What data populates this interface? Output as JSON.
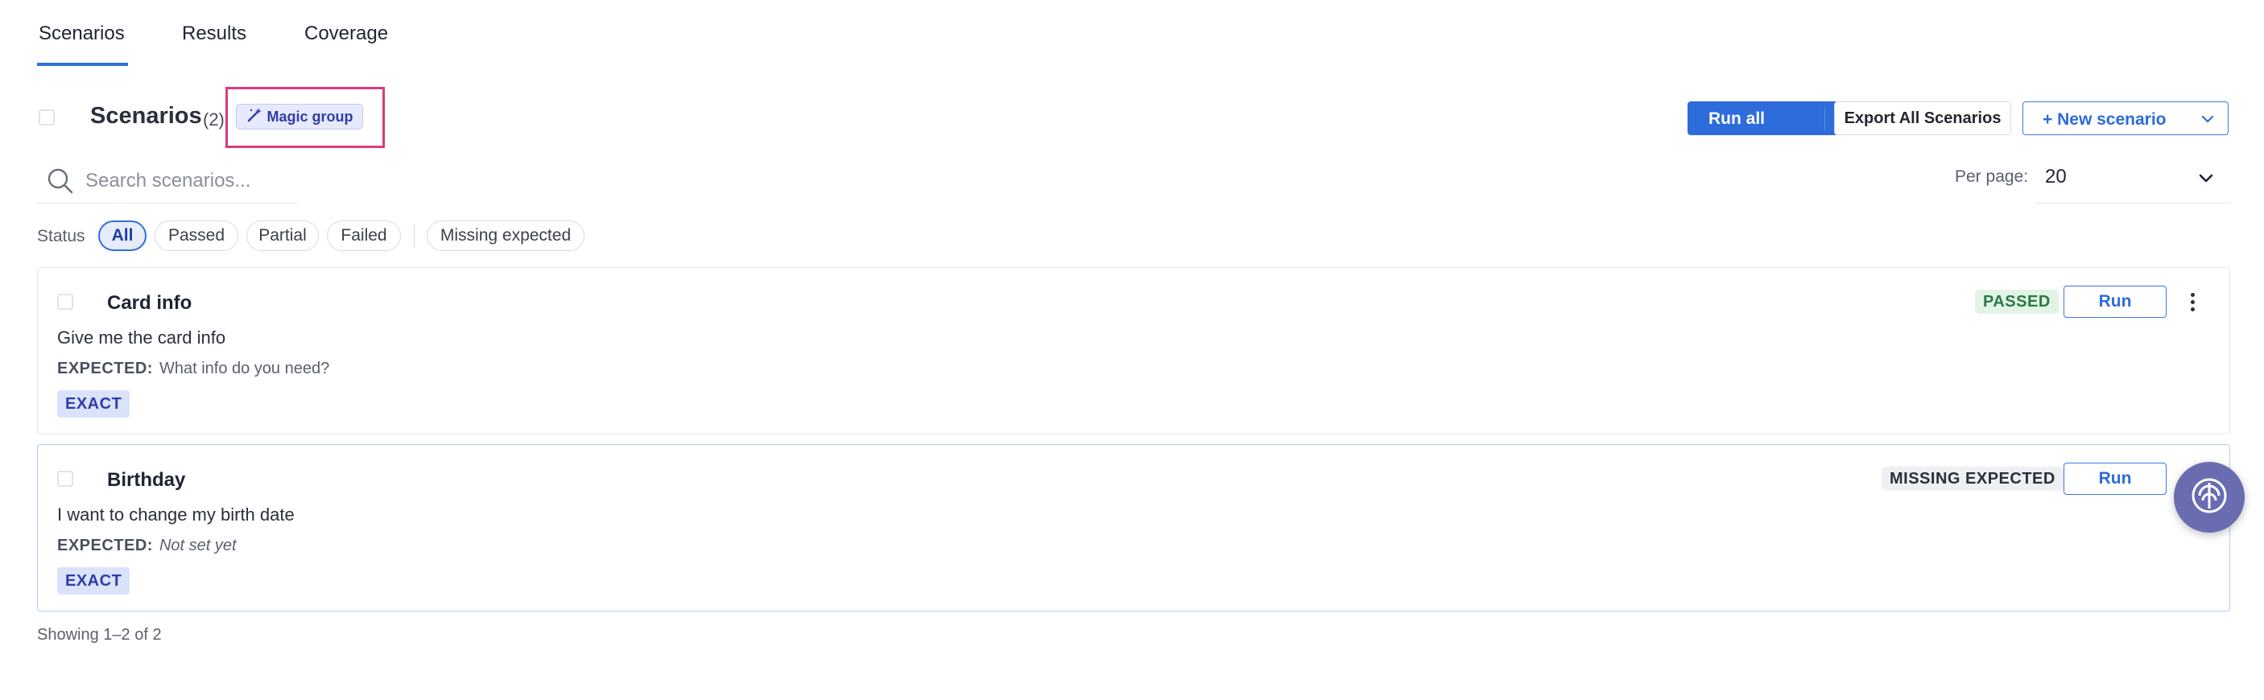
{
  "tabs": [
    {
      "label": "Scenarios",
      "active": true
    },
    {
      "label": "Results",
      "active": false
    },
    {
      "label": "Coverage",
      "active": false
    }
  ],
  "header": {
    "title": "Scenarios",
    "count": "(2)",
    "magic_group_label": "Magic group",
    "run_all_label": "Run all",
    "export_label": "Export All Scenarios",
    "new_scenario_label": "+ New scenario"
  },
  "search": {
    "placeholder": "Search scenarios...",
    "value": ""
  },
  "per_page": {
    "label": "Per page:",
    "value": "20"
  },
  "filters": {
    "label": "Status",
    "chips": [
      "All",
      "Passed",
      "Partial",
      "Failed",
      "Missing expected"
    ],
    "active": "All"
  },
  "scenarios": [
    {
      "title": "Card info",
      "input": "Give me the card info",
      "expected_key": "EXPECTED:",
      "expected_value": "What info do you need?",
      "match_type": "EXACT",
      "status": "PASSED",
      "run_label": "Run"
    },
    {
      "title": "Birthday",
      "input": "I want to change my birth date",
      "expected_key": "EXPECTED:",
      "expected_value": "Not set yet",
      "match_type": "EXACT",
      "status": "MISSING EXPECTED",
      "run_label": "Run"
    }
  ],
  "footer": {
    "showing": "Showing 1–2 of 2"
  },
  "colors": {
    "accent": "#2e6bdb",
    "highlight": "#d63d7c",
    "passed_bg": "#e3f3e6",
    "passed_text": "#2a7a44",
    "fab": "#6a6cb2"
  },
  "icons": [
    "magic-wand-icon",
    "chevron-down-icon",
    "search-icon",
    "kebab-menu-icon",
    "support-chat-icon"
  ]
}
